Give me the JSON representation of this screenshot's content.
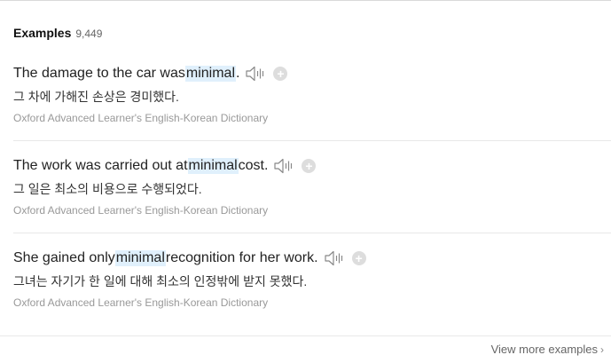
{
  "header": {
    "title": "Examples",
    "count": "9,449"
  },
  "examples": [
    {
      "before": "The damage to the car was ",
      "highlight": "minimal",
      "after": ".",
      "translation": "그 차에 가해진 손상은 경미했다.",
      "source": "Oxford Advanced Learner's English-Korean Dictionary"
    },
    {
      "before": "The work was carried out at ",
      "highlight": "minimal",
      "after": " cost.",
      "translation": "그 일은 최소의 비용으로 수행되었다.",
      "source": "Oxford Advanced Learner's English-Korean Dictionary"
    },
    {
      "before": "She gained only ",
      "highlight": "minimal",
      "after": " recognition for her work.",
      "translation": "그녀는 자기가 한 일에 대해 최소의 인정밖에 받지 못했다.",
      "source": "Oxford Advanced Learner's English-Korean Dictionary"
    }
  ],
  "icons": {
    "speaker": "speaker-icon",
    "add": "plus-circle-icon",
    "chevron": "chevron-right-icon"
  },
  "footer": {
    "view_more_label": "View more examples"
  },
  "colors": {
    "highlight": "#e0f0fc",
    "source_text": "#999999",
    "add_button": "#dddddd"
  }
}
